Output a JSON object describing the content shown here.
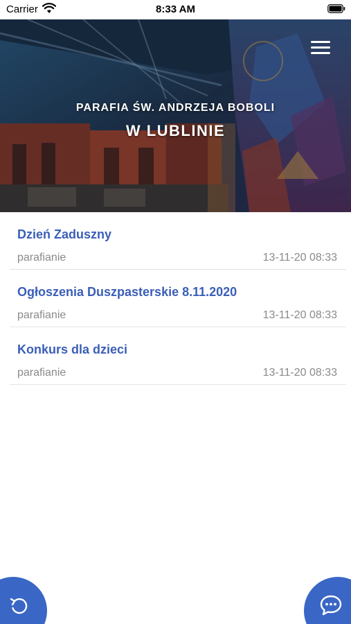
{
  "status_bar": {
    "carrier": "Carrier",
    "time": "8:33 AM",
    "wifi_icon": "wifi-icon",
    "battery_icon": "battery-icon"
  },
  "header": {
    "title": "PARAFIA ŚW. ANDRZEJA BOBOLI",
    "subtitle": "W LUBLINIE",
    "menu_icon": "hamburger-menu-icon"
  },
  "posts": [
    {
      "title": "Dzień Zaduszny",
      "author": "parafianie",
      "date": "13-11-20 08:33"
    },
    {
      "title": "Ogłoszenia Duszpasterskie 8.11.2020",
      "author": "parafianie",
      "date": "13-11-20 08:33"
    },
    {
      "title": "Konkurs dla dzieci",
      "author": "parafianie",
      "date": "13-11-20 08:33"
    }
  ],
  "fab": {
    "refresh_icon": "refresh-icon",
    "chat_icon": "chat-bubble-icon"
  },
  "colors": {
    "accent": "#3a66c6",
    "post_title": "#3a5eb8",
    "meta_text": "#8a8a8a",
    "divider": "#e3e3e3"
  }
}
